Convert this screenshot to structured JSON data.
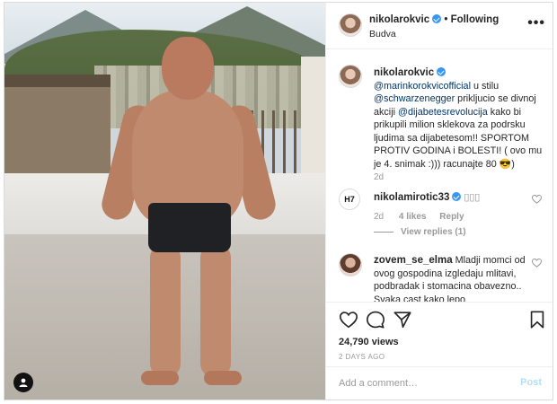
{
  "post": {
    "username": "nikolarokvic",
    "follow_label": "Following",
    "separator": "•",
    "location": "Budva",
    "more_icon": "more-horizontal-icon"
  },
  "caption": {
    "username": "nikolarokvic",
    "mention1": "@marinkorokvicofficial",
    "text1": " u stilu ",
    "mention2": "@schwarzenegger",
    "text2": " prikljucio se divnoj akciji ",
    "mention3": "@dijabetesrevolucija",
    "text3": " kako bi prikupili milion sklekova za podrsku ljudima sa dijabetesom!! SPORTOM PROTIV GODINA i BOLESTI! ( ovo mu je 4. snimak :))) racunajte 80 😎)",
    "time": "2d"
  },
  "comments": [
    {
      "username": "nikolamirotic33",
      "text": "▯▯▯",
      "time": "2d",
      "likes": "4 likes",
      "reply_label": "Reply",
      "view_replies": "View replies (1)",
      "avatar_text": "H7"
    },
    {
      "username": "zovem_se_elma",
      "text": "Mladji momci od ovog gospodina izgledaju mlitavi, podbradak i stomacina obavezno.. Svaka cast kako lepo"
    }
  ],
  "stats": {
    "views": "24,790 views",
    "ago": "2 DAYS AGO"
  },
  "composer": {
    "placeholder": "Add a comment…",
    "post_label": "Post"
  },
  "colors": {
    "link": "#003569",
    "verified": "#3897f0",
    "post_disabled": "#b2dffc"
  }
}
